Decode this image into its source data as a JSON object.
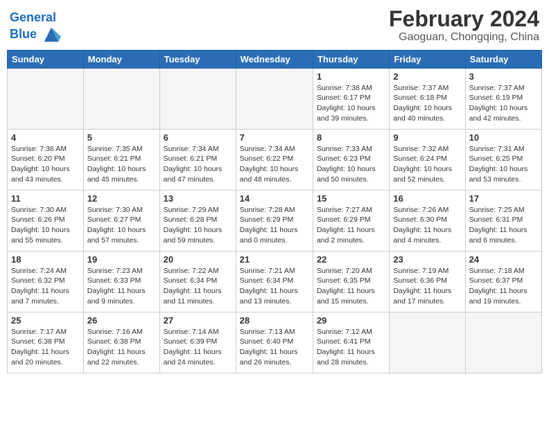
{
  "header": {
    "logo_line1": "General",
    "logo_line2": "Blue",
    "month": "February 2024",
    "location": "Gaoguan, Chongqing, China"
  },
  "days_of_week": [
    "Sunday",
    "Monday",
    "Tuesday",
    "Wednesday",
    "Thursday",
    "Friday",
    "Saturday"
  ],
  "weeks": [
    [
      {
        "day": "",
        "empty": true
      },
      {
        "day": "",
        "empty": true
      },
      {
        "day": "",
        "empty": true
      },
      {
        "day": "",
        "empty": true
      },
      {
        "day": "1",
        "sunrise": "7:38 AM",
        "sunset": "6:17 PM",
        "daylight": "10 hours and 39 minutes."
      },
      {
        "day": "2",
        "sunrise": "7:37 AM",
        "sunset": "6:18 PM",
        "daylight": "10 hours and 40 minutes."
      },
      {
        "day": "3",
        "sunrise": "7:37 AM",
        "sunset": "6:19 PM",
        "daylight": "10 hours and 42 minutes."
      }
    ],
    [
      {
        "day": "4",
        "sunrise": "7:36 AM",
        "sunset": "6:20 PM",
        "daylight": "10 hours and 43 minutes."
      },
      {
        "day": "5",
        "sunrise": "7:35 AM",
        "sunset": "6:21 PM",
        "daylight": "10 hours and 45 minutes."
      },
      {
        "day": "6",
        "sunrise": "7:34 AM",
        "sunset": "6:21 PM",
        "daylight": "10 hours and 47 minutes."
      },
      {
        "day": "7",
        "sunrise": "7:34 AM",
        "sunset": "6:22 PM",
        "daylight": "10 hours and 48 minutes."
      },
      {
        "day": "8",
        "sunrise": "7:33 AM",
        "sunset": "6:23 PM",
        "daylight": "10 hours and 50 minutes."
      },
      {
        "day": "9",
        "sunrise": "7:32 AM",
        "sunset": "6:24 PM",
        "daylight": "10 hours and 52 minutes."
      },
      {
        "day": "10",
        "sunrise": "7:31 AM",
        "sunset": "6:25 PM",
        "daylight": "10 hours and 53 minutes."
      }
    ],
    [
      {
        "day": "11",
        "sunrise": "7:30 AM",
        "sunset": "6:26 PM",
        "daylight": "10 hours and 55 minutes."
      },
      {
        "day": "12",
        "sunrise": "7:30 AM",
        "sunset": "6:27 PM",
        "daylight": "10 hours and 57 minutes."
      },
      {
        "day": "13",
        "sunrise": "7:29 AM",
        "sunset": "6:28 PM",
        "daylight": "10 hours and 59 minutes."
      },
      {
        "day": "14",
        "sunrise": "7:28 AM",
        "sunset": "6:29 PM",
        "daylight": "11 hours and 0 minutes."
      },
      {
        "day": "15",
        "sunrise": "7:27 AM",
        "sunset": "6:29 PM",
        "daylight": "11 hours and 2 minutes."
      },
      {
        "day": "16",
        "sunrise": "7:26 AM",
        "sunset": "6:30 PM",
        "daylight": "11 hours and 4 minutes."
      },
      {
        "day": "17",
        "sunrise": "7:25 AM",
        "sunset": "6:31 PM",
        "daylight": "11 hours and 6 minutes."
      }
    ],
    [
      {
        "day": "18",
        "sunrise": "7:24 AM",
        "sunset": "6:32 PM",
        "daylight": "11 hours and 7 minutes."
      },
      {
        "day": "19",
        "sunrise": "7:23 AM",
        "sunset": "6:33 PM",
        "daylight": "11 hours and 9 minutes."
      },
      {
        "day": "20",
        "sunrise": "7:22 AM",
        "sunset": "6:34 PM",
        "daylight": "11 hours and 11 minutes."
      },
      {
        "day": "21",
        "sunrise": "7:21 AM",
        "sunset": "6:34 PM",
        "daylight": "11 hours and 13 minutes."
      },
      {
        "day": "22",
        "sunrise": "7:20 AM",
        "sunset": "6:35 PM",
        "daylight": "11 hours and 15 minutes."
      },
      {
        "day": "23",
        "sunrise": "7:19 AM",
        "sunset": "6:36 PM",
        "daylight": "11 hours and 17 minutes."
      },
      {
        "day": "24",
        "sunrise": "7:18 AM",
        "sunset": "6:37 PM",
        "daylight": "11 hours and 19 minutes."
      }
    ],
    [
      {
        "day": "25",
        "sunrise": "7:17 AM",
        "sunset": "6:38 PM",
        "daylight": "11 hours and 20 minutes."
      },
      {
        "day": "26",
        "sunrise": "7:16 AM",
        "sunset": "6:38 PM",
        "daylight": "11 hours and 22 minutes."
      },
      {
        "day": "27",
        "sunrise": "7:14 AM",
        "sunset": "6:39 PM",
        "daylight": "11 hours and 24 minutes."
      },
      {
        "day": "28",
        "sunrise": "7:13 AM",
        "sunset": "6:40 PM",
        "daylight": "11 hours and 26 minutes."
      },
      {
        "day": "29",
        "sunrise": "7:12 AM",
        "sunset": "6:41 PM",
        "daylight": "11 hours and 28 minutes."
      },
      {
        "day": "",
        "empty": true
      },
      {
        "day": "",
        "empty": true
      }
    ]
  ]
}
